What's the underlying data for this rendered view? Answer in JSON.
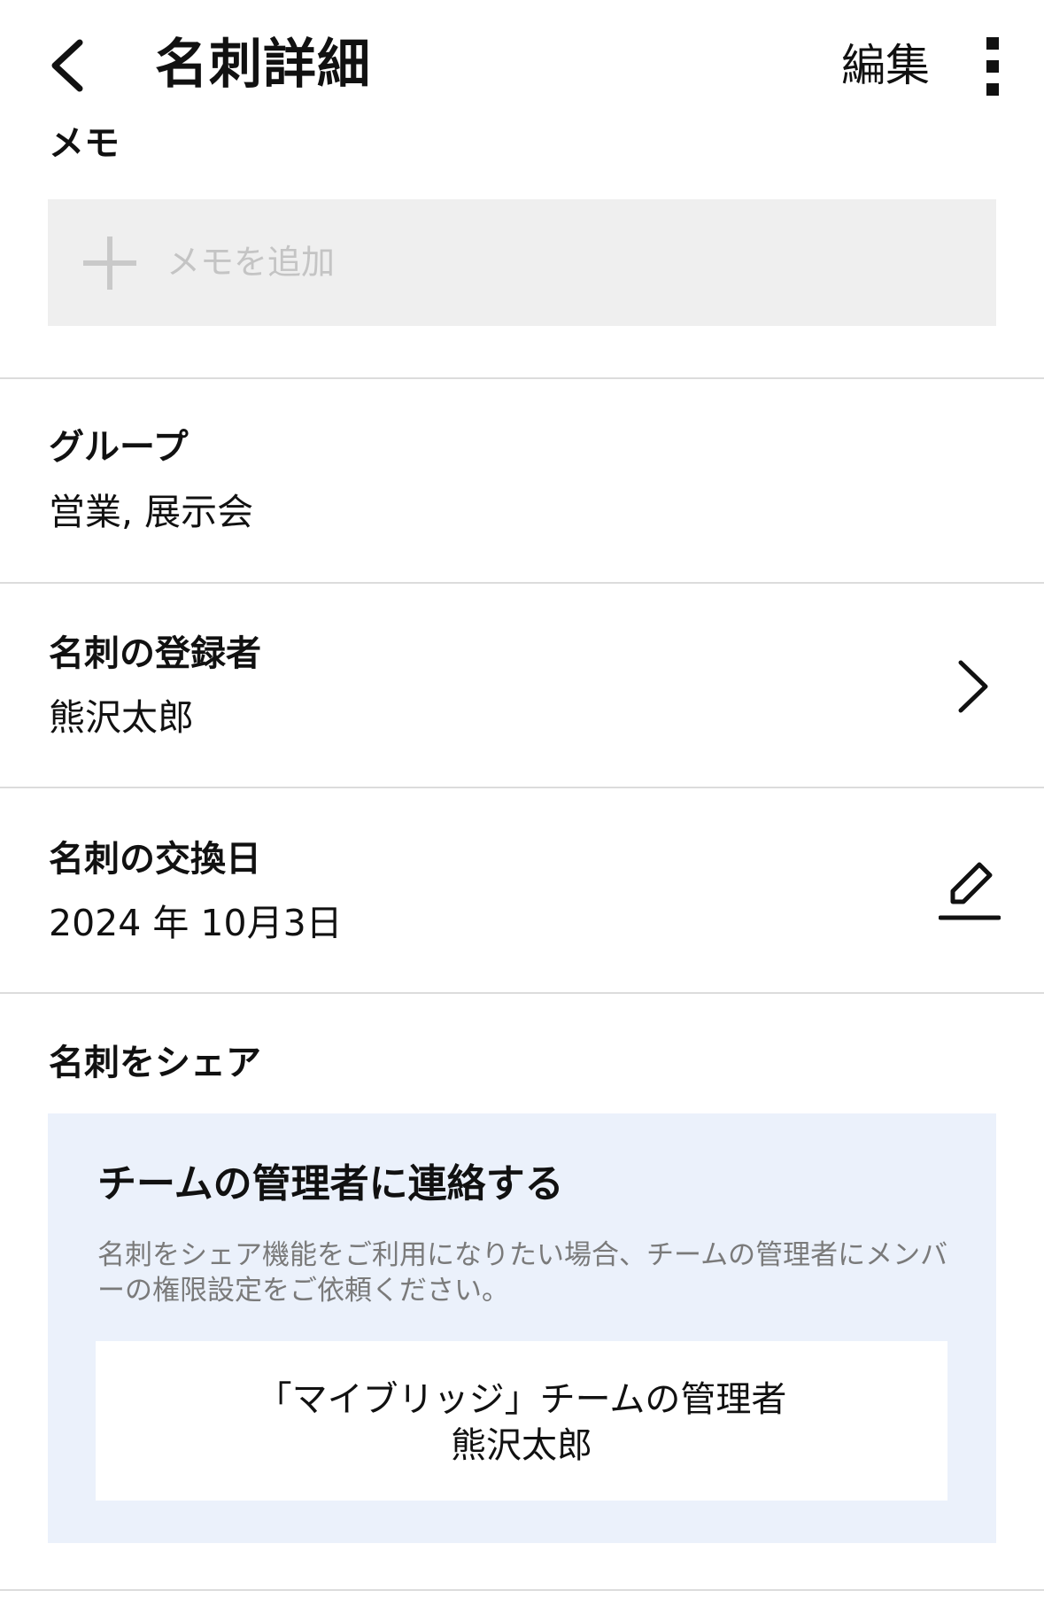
{
  "header": {
    "title": "名刺詳細",
    "edit_label": "編集"
  },
  "memo": {
    "label": "メモ",
    "placeholder": "メモを追加"
  },
  "group": {
    "label": "グループ",
    "value": "営業, 展示会"
  },
  "registrant": {
    "label": "名刺の登録者",
    "value": "熊沢太郎"
  },
  "exchange_date": {
    "label": "名刺の交換日",
    "value": "2024 年 10月3日"
  },
  "share": {
    "label": "名刺をシェア",
    "card_title": "チームの管理者に連絡する",
    "card_description": "名刺をシェア機能をご利用になりたい場合、チームの管理者にメンバーの権限設定をご依頼ください。",
    "admin_team": "「マイブリッジ」チームの管理者",
    "admin_name": "熊沢太郎"
  },
  "icons": {
    "back": "chevron-left-icon",
    "more": "more-vertical-icon",
    "add": "plus-icon",
    "forward": "chevron-right-icon",
    "edit": "pencil-icon"
  }
}
